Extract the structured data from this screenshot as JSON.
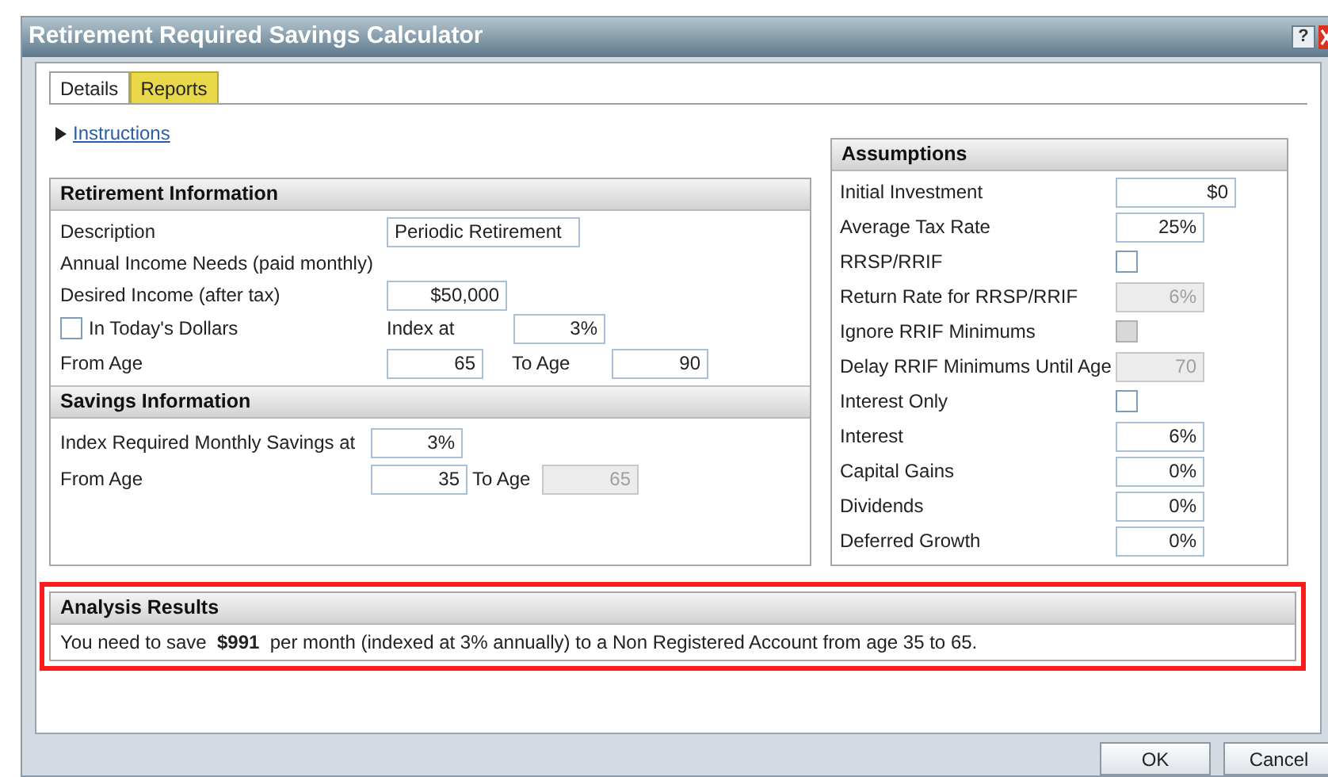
{
  "window": {
    "title": "Retirement Required Savings Calculator",
    "help": "?"
  },
  "tabs": [
    {
      "label": "Details",
      "selected": true
    },
    {
      "label": "Reports",
      "selected": false
    }
  ],
  "instructions": {
    "label": "Instructions",
    "expanded": false
  },
  "retirement_information": {
    "title": "Retirement Information",
    "description": {
      "label": "Description",
      "value": "Periodic Retirement"
    },
    "note": "Annual Income Needs (paid monthly)",
    "desired_income": {
      "label": "Desired Income (after tax)",
      "value": "$50,000"
    },
    "in_todays_dollars": {
      "label": "In Today's Dollars",
      "checked": false
    },
    "index_at": {
      "label": "Index at",
      "value": "3%"
    },
    "from_age": {
      "label": "From Age",
      "value": "65"
    },
    "to_age": {
      "label": "To Age",
      "value": "90"
    }
  },
  "savings_information": {
    "title": "Savings Information",
    "index": {
      "label": "Index Required Monthly Savings at",
      "value": "3%"
    },
    "from_age": {
      "label": "From Age",
      "value": "35"
    },
    "to_age": {
      "label": "To Age",
      "value": "65",
      "disabled": true
    }
  },
  "assumptions": {
    "title": "Assumptions",
    "rows": [
      {
        "label": "Initial Investment",
        "kind": "text",
        "value": "$0",
        "disabled": false
      },
      {
        "label": "Average Tax Rate",
        "kind": "text",
        "value": "25%",
        "disabled": false
      },
      {
        "label": "RRSP/RRIF",
        "kind": "checkbox",
        "checked": false,
        "disabled": false
      },
      {
        "label": "Return Rate for RRSP/RRIF",
        "kind": "text",
        "value": "6%",
        "disabled": true
      },
      {
        "label": "Ignore RRIF Minimums",
        "kind": "checkbox",
        "checked": false,
        "disabled": true
      },
      {
        "label": "Delay RRIF Minimums Until Age",
        "kind": "text",
        "value": "70",
        "disabled": true
      },
      {
        "label": "Interest Only",
        "kind": "checkbox",
        "checked": false,
        "disabled": false
      },
      {
        "label": "Interest",
        "kind": "text",
        "value": "6%",
        "disabled": false
      },
      {
        "label": "Capital Gains",
        "kind": "text",
        "value": "0%",
        "disabled": false
      },
      {
        "label": "Dividends",
        "kind": "text",
        "value": "0%",
        "disabled": false
      },
      {
        "label": "Deferred Growth",
        "kind": "text",
        "value": "0%",
        "disabled": false
      }
    ]
  },
  "analysis_results": {
    "title": "Analysis Results",
    "highlighted": true,
    "text": "You need to save  **$991**  per month (indexed at 3% annually) to a Non Registered Account from age 35 to 65."
  },
  "buttons": [
    {
      "label": "OK"
    },
    {
      "label": "Cancel"
    }
  ]
}
